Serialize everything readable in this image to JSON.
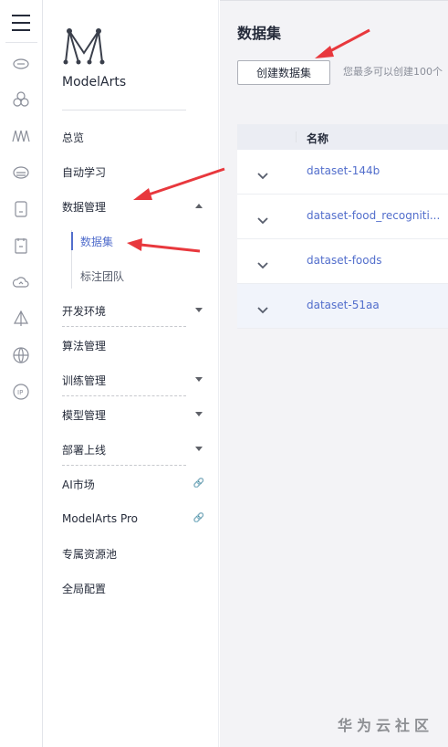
{
  "rail": {
    "icons": [
      "menu-icon",
      "cloud-icon",
      "cluster-icon",
      "waveform-icon",
      "cloud-server-icon",
      "device-icon",
      "document-icon",
      "cloud-upload-icon",
      "sail-icon",
      "globe-icon",
      "ip-icon"
    ]
  },
  "brand": {
    "name": "ModelArts"
  },
  "nav": {
    "overview": "总览",
    "auto_learning": "自动学习",
    "data_management": "数据管理",
    "datasets": "数据集",
    "labeling_teams": "标注团队",
    "dev_env": "开发环境",
    "algorithm_mgmt": "算法管理",
    "training_mgmt": "训练管理",
    "model_mgmt": "模型管理",
    "deploy": "部署上线",
    "ai_market": "AI市场",
    "modelarts_pro": "ModelArts Pro",
    "dedicated_pool": "专属资源池",
    "global_config": "全局配置",
    "link_glyph": "🔗"
  },
  "main": {
    "title": "数据集",
    "create_button": "创建数据集",
    "quota_text": "您最多可以创建100个",
    "table": {
      "header_name": "名称",
      "rows": [
        {
          "name": "dataset-144b"
        },
        {
          "name": "dataset-food_recogniti..."
        },
        {
          "name": "dataset-foods"
        },
        {
          "name": "dataset-51aa"
        }
      ]
    }
  },
  "watermark": "华为云社区",
  "colors": {
    "accent": "#526ecc",
    "arrow": "#e8383d"
  }
}
